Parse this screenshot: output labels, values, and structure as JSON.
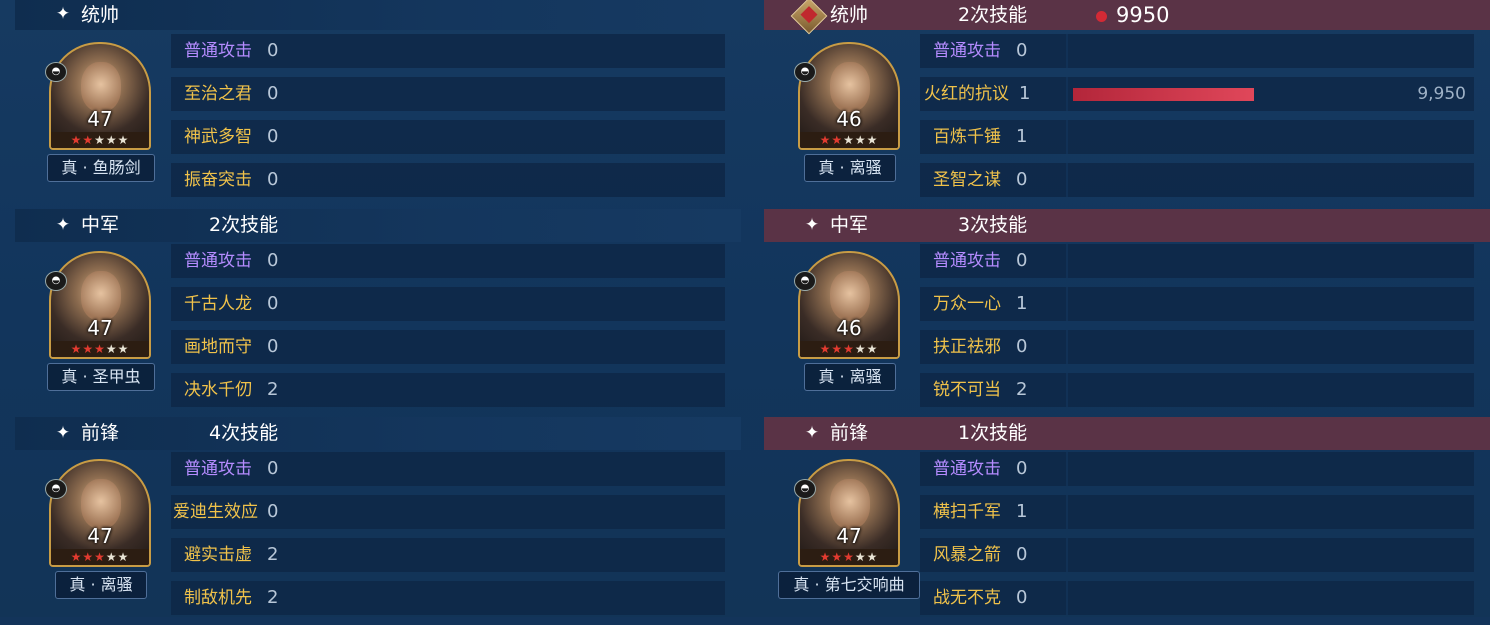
{
  "left": {
    "sections": [
      {
        "role": "统帅",
        "count": "",
        "level": "47",
        "stars_red": 2,
        "stars_white": 3,
        "weapon": "真 · 鱼肠剑",
        "skills": [
          {
            "name": "普通攻击",
            "count": "0"
          },
          {
            "name": "至治之君",
            "count": "0"
          },
          {
            "name": "神武多智",
            "count": "0"
          },
          {
            "name": "振奋突击",
            "count": "0"
          }
        ]
      },
      {
        "role": "中军",
        "count": "2次技能",
        "level": "47",
        "stars_red": 3,
        "stars_white": 2,
        "weapon": "真 · 圣甲虫",
        "skills": [
          {
            "name": "普通攻击",
            "count": "0"
          },
          {
            "name": "千古人龙",
            "count": "0"
          },
          {
            "name": "画地而守",
            "count": "0"
          },
          {
            "name": "决水千仞",
            "count": "2"
          }
        ]
      },
      {
        "role": "前锋",
        "count": "4次技能",
        "level": "47",
        "stars_red": 3,
        "stars_white": 2,
        "weapon": "真 · 离骚",
        "skills": [
          {
            "name": "普通攻击",
            "count": "0"
          },
          {
            "name": "爱迪生效应",
            "count": "0"
          },
          {
            "name": "避实击虚",
            "count": "2"
          },
          {
            "name": "制敌机先",
            "count": "2"
          }
        ]
      }
    ]
  },
  "right": {
    "damage_total": "9950",
    "sections": [
      {
        "role": "统帅",
        "count": "2次技能",
        "level": "46",
        "stars_red": 2,
        "stars_white": 3,
        "weapon": "真 · 离骚",
        "skills": [
          {
            "name": "普通攻击",
            "count": "0"
          },
          {
            "name": "火红的抗议",
            "count": "1",
            "damage_fraction": 1.0,
            "damage_label": "9,950"
          },
          {
            "name": "百炼千锤",
            "count": "1"
          },
          {
            "name": "圣智之谋",
            "count": "0"
          }
        ]
      },
      {
        "role": "中军",
        "count": "3次技能",
        "level": "46",
        "stars_red": 3,
        "stars_white": 2,
        "weapon": "真 · 离骚",
        "skills": [
          {
            "name": "普通攻击",
            "count": "0"
          },
          {
            "name": "万众一心",
            "count": "1"
          },
          {
            "name": "扶正祛邪",
            "count": "0"
          },
          {
            "name": "锐不可当",
            "count": "2"
          }
        ]
      },
      {
        "role": "前锋",
        "count": "1次技能",
        "level": "47",
        "stars_red": 3,
        "stars_white": 2,
        "weapon": "真 · 第七交响曲",
        "skills": [
          {
            "name": "普通攻击",
            "count": "0"
          },
          {
            "name": "横扫千军",
            "count": "1"
          },
          {
            "name": "风暴之箭",
            "count": "0"
          },
          {
            "name": "战无不克",
            "count": "0"
          }
        ]
      }
    ]
  },
  "colors": {
    "attack_skill": "#b58cff",
    "skill": "#f0c24a",
    "damage_bar": "#c8334a",
    "enemy_header": "#5a3346"
  },
  "icons": {
    "role_icon": "sparkle-icon",
    "commander_icon": "sword-emblem-icon",
    "badge_icon": "horse-badge-icon"
  }
}
